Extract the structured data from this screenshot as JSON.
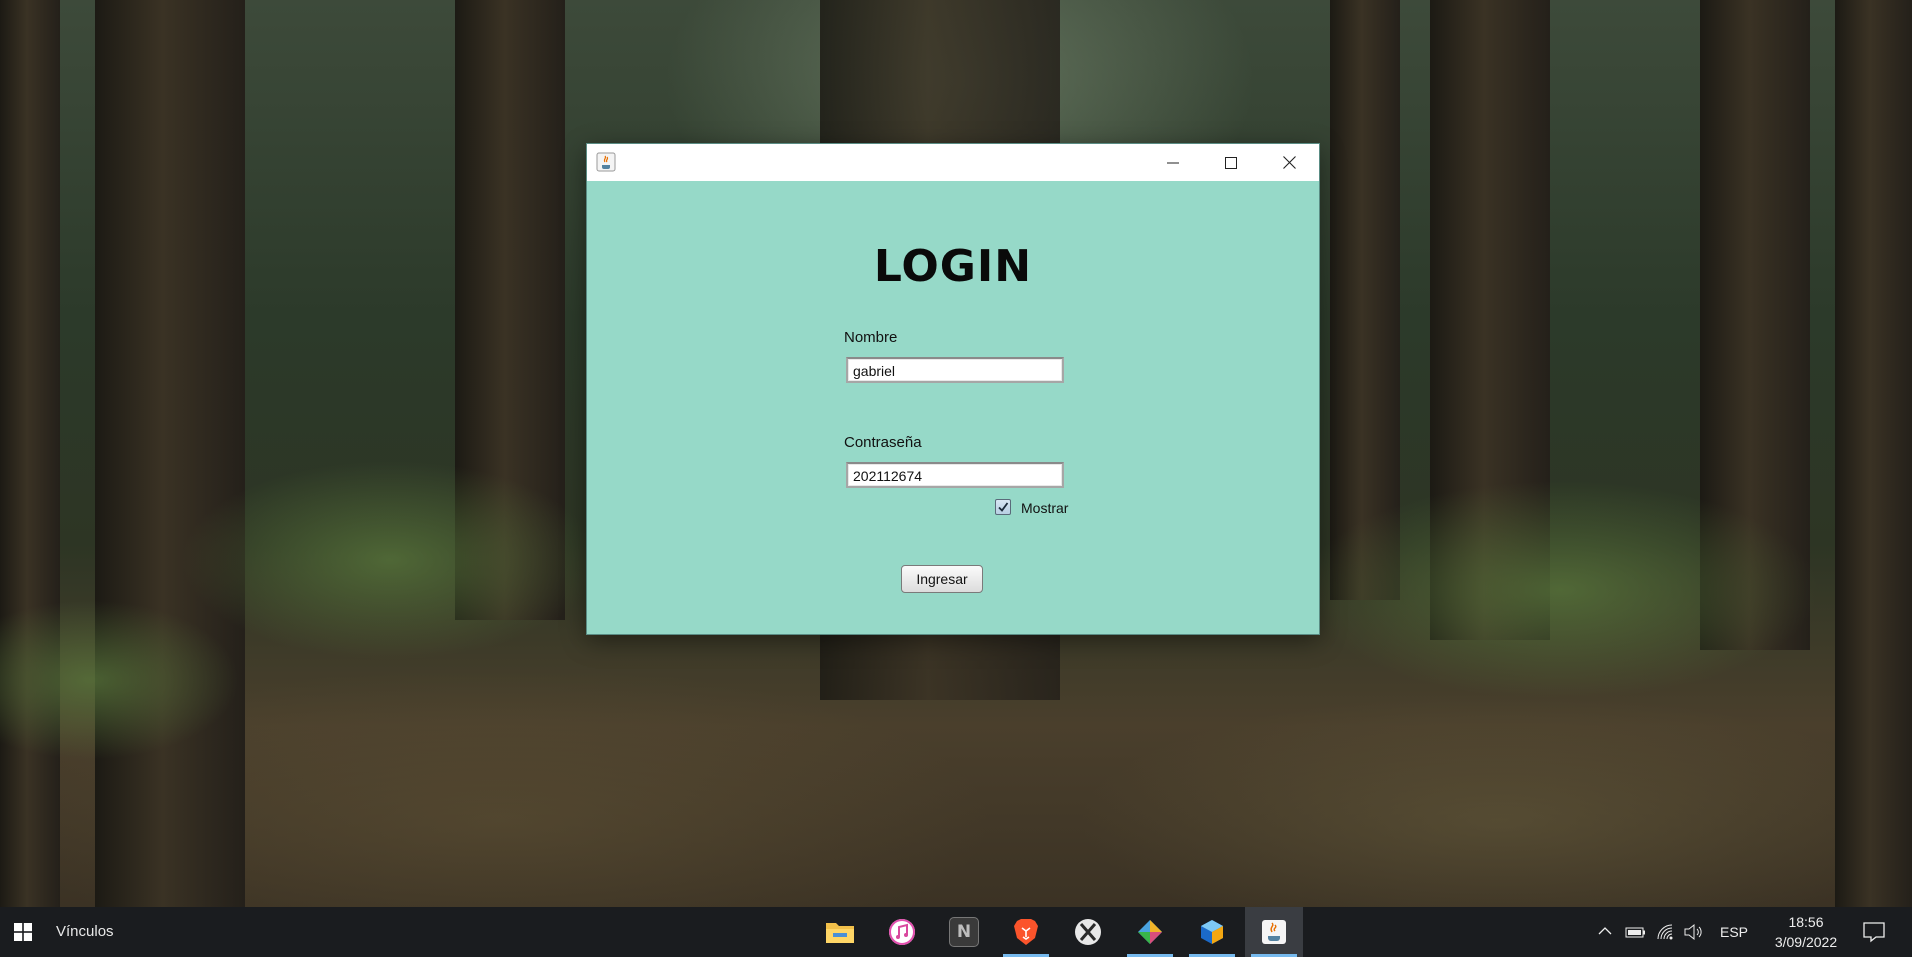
{
  "window": {
    "title": "",
    "background_color": "#96d9c8",
    "controls": {
      "minimize_icon": "minimize-icon",
      "maximize_icon": "maximize-icon",
      "close_icon": "close-icon"
    }
  },
  "login": {
    "title": "LOGIN",
    "name_label": "Nombre",
    "name_value": "gabriel",
    "password_label": "Contraseña",
    "password_value": "202112674",
    "show_checkbox_label": "Mostrar",
    "show_checked": true,
    "submit_label": "Ingresar"
  },
  "taskbar": {
    "toolbar_label": "Vínculos",
    "apps": [
      {
        "name": "file-explorer",
        "icon": "folder-icon",
        "running": false
      },
      {
        "name": "itunes",
        "icon": "music-note-icon",
        "running": false
      },
      {
        "name": "notion",
        "icon": "n-icon",
        "running": false
      },
      {
        "name": "brave",
        "icon": "lion-shield-icon",
        "running": true
      },
      {
        "name": "xbox",
        "icon": "x-icon",
        "running": false
      },
      {
        "name": "gitkraken",
        "icon": "diamond-icon",
        "running": true
      },
      {
        "name": "netbeans",
        "icon": "cube-icon",
        "running": true
      },
      {
        "name": "java",
        "icon": "coffee-cup-icon",
        "running": true,
        "active": true
      }
    ],
    "language": "ESP",
    "time": "18:56",
    "date": "3/09/2022"
  }
}
